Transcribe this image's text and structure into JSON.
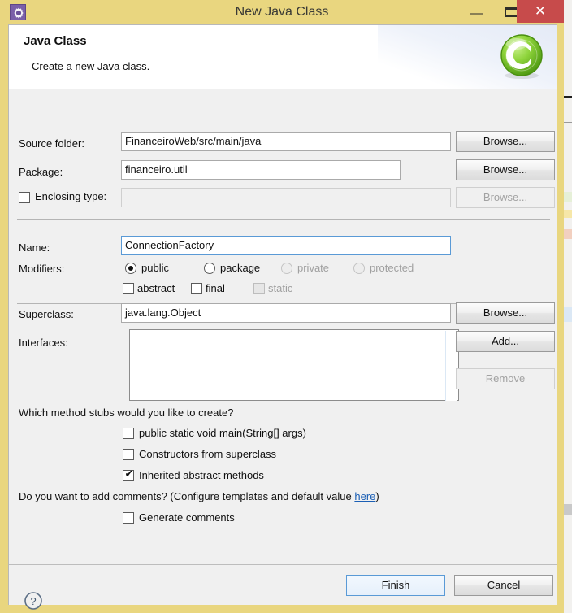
{
  "window": {
    "title": "New Java Class",
    "icon": "eclipse-wizard-gear-icon",
    "controls": {
      "minimize": "—",
      "maximize": "□",
      "close": "✕"
    },
    "frame_color": "#e9d67f",
    "close_color": "#c74b4b"
  },
  "header": {
    "title": "Java Class",
    "description": "Create a new Java class.",
    "banner_icon": "green-class-badge-icon",
    "banner_color": "#6ec82a"
  },
  "form": {
    "source_folder": {
      "label": "Source folder:",
      "value": "FinanceiroWeb/src/main/java",
      "browse_label": "Browse..."
    },
    "package": {
      "label": "Package:",
      "value": "financeiro.util",
      "browse_label": "Browse..."
    },
    "enclosing_type": {
      "label": "Enclosing type:",
      "checked": false,
      "value": "",
      "browse_label": "Browse...",
      "enabled": false
    },
    "name": {
      "label": "Name:",
      "value": "ConnectionFactory",
      "focused": true
    },
    "modifiers": {
      "label": "Modifiers:",
      "access": [
        {
          "label": "public",
          "selected": true,
          "enabled": true
        },
        {
          "label": "package",
          "selected": false,
          "enabled": true
        },
        {
          "label": "private",
          "selected": false,
          "enabled": false
        },
        {
          "label": "protected",
          "selected": false,
          "enabled": false
        }
      ],
      "flags": [
        {
          "label": "abstract",
          "checked": false,
          "enabled": true
        },
        {
          "label": "final",
          "checked": false,
          "enabled": true
        },
        {
          "label": "static",
          "checked": false,
          "enabled": false
        }
      ]
    },
    "superclass": {
      "label": "Superclass:",
      "value": "java.lang.Object",
      "browse_label": "Browse..."
    },
    "interfaces": {
      "label": "Interfaces:",
      "items": [],
      "add_label": "Add...",
      "remove_label": "Remove",
      "remove_enabled": false
    }
  },
  "stubs": {
    "question": "Which method stubs would you like to create?",
    "options": [
      {
        "label": "public static void main(String[] args)",
        "checked": false
      },
      {
        "label": "Constructors from superclass",
        "checked": false
      },
      {
        "label": "Inherited abstract methods",
        "checked": true
      }
    ]
  },
  "comments": {
    "question_prefix": "Do you want to add comments? (Configure templates and default value ",
    "link_label": "here",
    "question_suffix": ")",
    "option": {
      "label": "Generate comments",
      "checked": false
    }
  },
  "footer": {
    "help_icon": "help-question-icon",
    "finish_label": "Finish",
    "cancel_label": "Cancel",
    "default_button": "Finish"
  },
  "check_glyph": "✔"
}
